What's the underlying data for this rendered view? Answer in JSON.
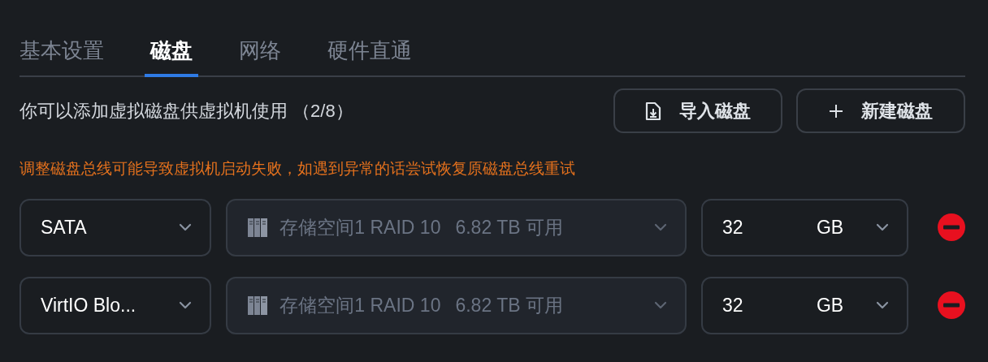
{
  "tabs": [
    {
      "label": "基本设置",
      "selected": false
    },
    {
      "label": "磁盘",
      "selected": true
    },
    {
      "label": "网络",
      "selected": false
    },
    {
      "label": "硬件直通",
      "selected": false
    }
  ],
  "intro": {
    "text": "你可以添加虚拟磁盘供虚拟机使用",
    "count": "（2/8）"
  },
  "buttons": [
    {
      "kind": "import",
      "label": "导入磁盘"
    },
    {
      "kind": "add",
      "label": "新建磁盘"
    }
  ],
  "warning": "调整磁盘总线可能导致虚拟机启动失败，如遇到异常的话尝试恢复原磁盘总线重试",
  "disks": [
    {
      "bus": "SATA",
      "storage": {
        "name": "存储空间1 RAID 10",
        "free": "6.82 TB 可用",
        "disabled": true
      },
      "size": "32",
      "unit": "GB"
    },
    {
      "bus": "VirtIO Blo...",
      "storage": {
        "name": "存储空间1 RAID 10",
        "free": "6.82 TB 可用",
        "disabled": true
      },
      "size": "32",
      "unit": "GB"
    }
  ]
}
